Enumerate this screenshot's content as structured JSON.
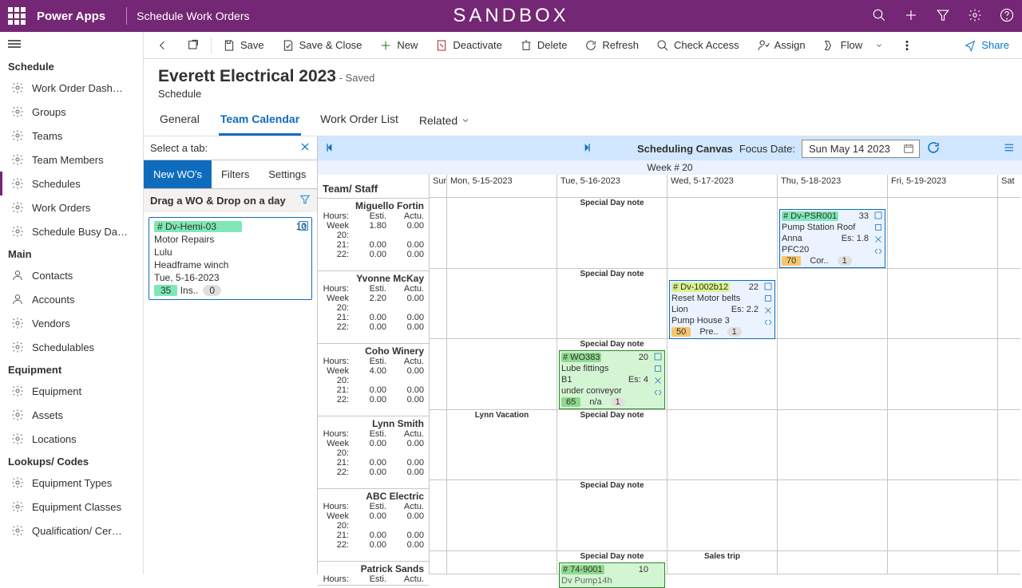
{
  "topbar": {
    "brand": "Power Apps",
    "page": "Schedule Work Orders",
    "sandbox": "SANDBOX"
  },
  "leftnav": {
    "groups": [
      {
        "header": "Schedule",
        "items": [
          "Work Order Dash…",
          "Groups",
          "Teams",
          "Team Members",
          "Schedules",
          "Work Orders",
          "Schedule Busy Da…"
        ],
        "active": 4
      },
      {
        "header": "Main",
        "items": [
          "Contacts",
          "Accounts",
          "Vendors",
          "Schedulables"
        ]
      },
      {
        "header": "Equipment",
        "items": [
          "Equipment",
          "Assets",
          "Locations"
        ]
      },
      {
        "header": "Lookups/ Codes",
        "items": [
          "Equipment Types",
          "Equipment Classes",
          "Qualification/ Cer…"
        ]
      }
    ]
  },
  "cmd": {
    "save": "Save",
    "saveclose": "Save & Close",
    "new": "New",
    "deactivate": "Deactivate",
    "delete": "Delete",
    "refresh": "Refresh",
    "check": "Check Access",
    "assign": "Assign",
    "flow": "Flow",
    "share": "Share"
  },
  "record": {
    "title": "Everett Electrical 2023",
    "saved": "- Saved",
    "entity": "Schedule"
  },
  "formtabs": [
    "General",
    "Team Calendar",
    "Work Order List",
    "Related"
  ],
  "wopanel": {
    "selectTab": "Select a tab:",
    "tabs": [
      "New WO's",
      "Filters",
      "Settings"
    ],
    "dragHeader": "Drag a WO & Drop on a day",
    "card": {
      "id": "# Dv-Hemi-03",
      "due": "10",
      "desc": "Motor Repairs",
      "client": "Lulu",
      "asset": "Headframe winch",
      "date": "Tue, 5-16-2023",
      "bar": "35",
      "status": "Ins..",
      "count": "0"
    }
  },
  "calendar": {
    "heading": "Scheduling Canvas",
    "focusLabel": "Focus Date:",
    "focusDate": "Sun May 14 2023",
    "weekNum": "Week # 20",
    "teamHeader": "Team/ Staff",
    "dayHeaders": [
      "Sun",
      "Mon, 5-15-2023",
      "Tue, 5-16-2023",
      "Wed, 5-17-2023",
      "Thu, 5-18-2023",
      "Fri, 5-19-2023",
      "Sat"
    ],
    "rowLabels": {
      "hours": "Hours:",
      "esti": "Esti.",
      "actu": "Actu.",
      "w20": "Week 20:",
      "w21": "21:",
      "w22": "22:"
    },
    "staff": [
      {
        "name": "Miguello Fortin",
        "w20e": "1.80",
        "w20a": "0.00",
        "w21e": "0.00",
        "w21a": "0.00",
        "w22e": "0.00",
        "w22a": "0.00"
      },
      {
        "name": "Yvonne McKay",
        "w20e": "2.20",
        "w20a": "0.00",
        "w21e": "0.00",
        "w21a": "0.00",
        "w22e": "0.00",
        "w22a": "0.00"
      },
      {
        "name": "Coho Winery",
        "w20e": "4.00",
        "w20a": "0.00",
        "w21e": "0.00",
        "w21a": "0.00",
        "w22e": "0.00",
        "w22a": "0.00"
      },
      {
        "name": "Lynn Smith",
        "w20e": "0.00",
        "w20a": "0.00",
        "w21e": "0.00",
        "w21a": "0.00",
        "w22e": "0.00",
        "w22a": "0.00"
      },
      {
        "name": "ABC Electric",
        "w20e": "0.00",
        "w20a": "0.00",
        "w21e": "0.00",
        "w21a": "0.00",
        "w22e": "0.00",
        "w22a": "0.00"
      },
      {
        "name": "Patrick Sands",
        "hoursonly": true
      }
    ],
    "specialNote": "Special Day note",
    "lynnNote": "Lynn Vacation",
    "salesNote": "Sales trip",
    "cards": {
      "psr": {
        "id": "# Dv-PSR001",
        "num": "33",
        "l1": "Pump Station Roof",
        "l2a": "Anna",
        "l2b": "Es: 1.8",
        "l3": "PFC20",
        "bar": "70",
        "status": "Cor..",
        "cnt": "1"
      },
      "dv1002": {
        "id": "# Dv-1002b12",
        "num": "22",
        "l1": "Reset Motor belts",
        "l2a": "Lion",
        "l2b": "Es: 2.2",
        "l3": "Pump House 3",
        "bar": "50",
        "status": "Pre..",
        "cnt": "1"
      },
      "wo383": {
        "id": "# WO383",
        "num": "20",
        "l1": "Lube fittings",
        "l2a": "B1",
        "l2b": "Es: 4",
        "l3": "under conveyor",
        "bar": "65",
        "status": "n/a",
        "cnt": "1"
      },
      "w749": {
        "id": "# 74-9001",
        "num": "10",
        "l1": "Dv Pump14h"
      }
    }
  }
}
